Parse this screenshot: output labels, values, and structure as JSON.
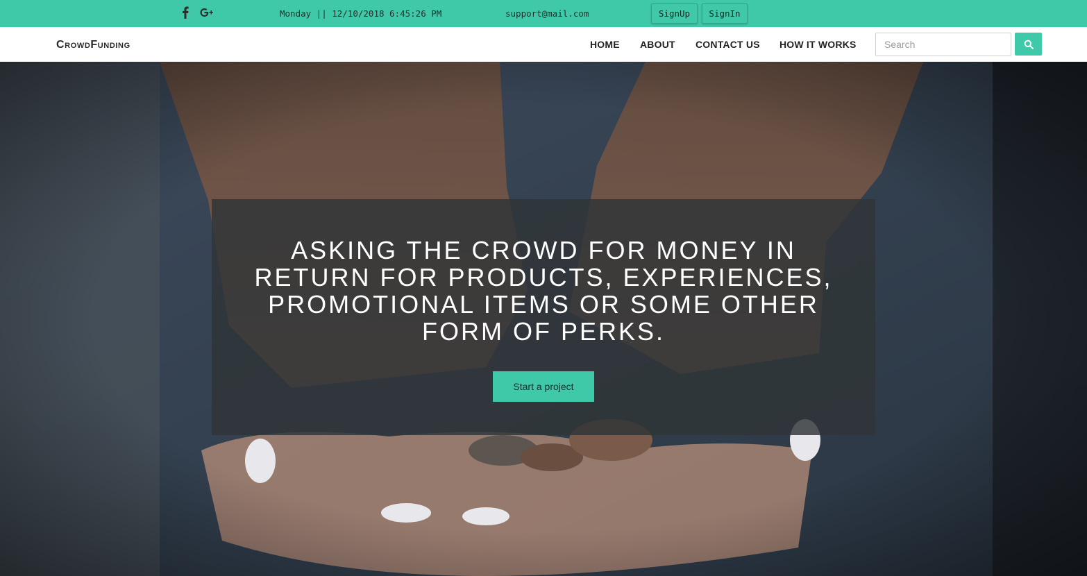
{
  "topbar": {
    "social": [
      "facebook-icon",
      "google-plus-icon"
    ],
    "datetime": "Monday || 12/10/2018 6:45:26 PM",
    "email": "support@mail.com",
    "signup_label": "SignUp",
    "signin_label": "SignIn"
  },
  "navbar": {
    "brand": "CrowdFunding",
    "links": [
      {
        "label": "HOME"
      },
      {
        "label": "ABOUT"
      },
      {
        "label": "CONTACT US"
      },
      {
        "label": "HOW IT WORKS"
      }
    ],
    "search": {
      "placeholder": "Search",
      "value": ""
    },
    "search_icon": "search-icon"
  },
  "hero": {
    "headline": "ASKING THE CROWD FOR MONEY IN RETURN FOR PRODUCTS, EXPERIENCES, PROMOTIONAL ITEMS OR SOME OTHER FORM OF PERKS.",
    "cta_label": "Start a project"
  },
  "colors": {
    "accent": "#40c9a9",
    "overlay": "#303437",
    "nav_bg": "#ffffff",
    "text_dark": "#222222"
  }
}
